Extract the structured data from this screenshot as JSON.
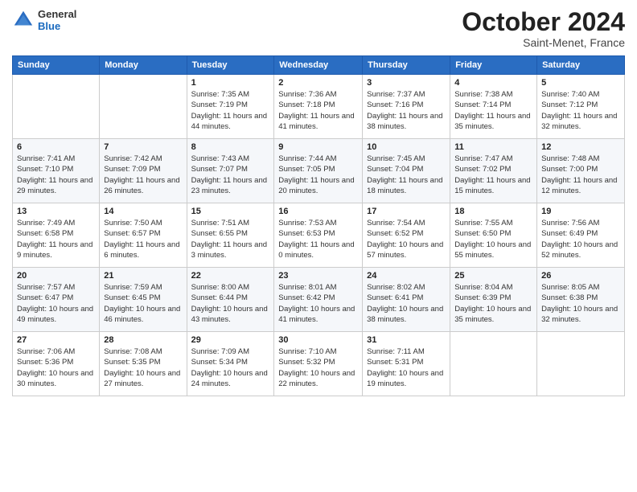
{
  "header": {
    "logo": {
      "general": "General",
      "blue": "Blue"
    },
    "title": "October 2024",
    "location": "Saint-Menet, France"
  },
  "days_of_week": [
    "Sunday",
    "Monday",
    "Tuesday",
    "Wednesday",
    "Thursday",
    "Friday",
    "Saturday"
  ],
  "weeks": [
    [
      {
        "day": "",
        "info": ""
      },
      {
        "day": "",
        "info": ""
      },
      {
        "day": "1",
        "sunrise": "Sunrise: 7:35 AM",
        "sunset": "Sunset: 7:19 PM",
        "daylight": "Daylight: 11 hours and 44 minutes."
      },
      {
        "day": "2",
        "sunrise": "Sunrise: 7:36 AM",
        "sunset": "Sunset: 7:18 PM",
        "daylight": "Daylight: 11 hours and 41 minutes."
      },
      {
        "day": "3",
        "sunrise": "Sunrise: 7:37 AM",
        "sunset": "Sunset: 7:16 PM",
        "daylight": "Daylight: 11 hours and 38 minutes."
      },
      {
        "day": "4",
        "sunrise": "Sunrise: 7:38 AM",
        "sunset": "Sunset: 7:14 PM",
        "daylight": "Daylight: 11 hours and 35 minutes."
      },
      {
        "day": "5",
        "sunrise": "Sunrise: 7:40 AM",
        "sunset": "Sunset: 7:12 PM",
        "daylight": "Daylight: 11 hours and 32 minutes."
      }
    ],
    [
      {
        "day": "6",
        "sunrise": "Sunrise: 7:41 AM",
        "sunset": "Sunset: 7:10 PM",
        "daylight": "Daylight: 11 hours and 29 minutes."
      },
      {
        "day": "7",
        "sunrise": "Sunrise: 7:42 AM",
        "sunset": "Sunset: 7:09 PM",
        "daylight": "Daylight: 11 hours and 26 minutes."
      },
      {
        "day": "8",
        "sunrise": "Sunrise: 7:43 AM",
        "sunset": "Sunset: 7:07 PM",
        "daylight": "Daylight: 11 hours and 23 minutes."
      },
      {
        "day": "9",
        "sunrise": "Sunrise: 7:44 AM",
        "sunset": "Sunset: 7:05 PM",
        "daylight": "Daylight: 11 hours and 20 minutes."
      },
      {
        "day": "10",
        "sunrise": "Sunrise: 7:45 AM",
        "sunset": "Sunset: 7:04 PM",
        "daylight": "Daylight: 11 hours and 18 minutes."
      },
      {
        "day": "11",
        "sunrise": "Sunrise: 7:47 AM",
        "sunset": "Sunset: 7:02 PM",
        "daylight": "Daylight: 11 hours and 15 minutes."
      },
      {
        "day": "12",
        "sunrise": "Sunrise: 7:48 AM",
        "sunset": "Sunset: 7:00 PM",
        "daylight": "Daylight: 11 hours and 12 minutes."
      }
    ],
    [
      {
        "day": "13",
        "sunrise": "Sunrise: 7:49 AM",
        "sunset": "Sunset: 6:58 PM",
        "daylight": "Daylight: 11 hours and 9 minutes."
      },
      {
        "day": "14",
        "sunrise": "Sunrise: 7:50 AM",
        "sunset": "Sunset: 6:57 PM",
        "daylight": "Daylight: 11 hours and 6 minutes."
      },
      {
        "day": "15",
        "sunrise": "Sunrise: 7:51 AM",
        "sunset": "Sunset: 6:55 PM",
        "daylight": "Daylight: 11 hours and 3 minutes."
      },
      {
        "day": "16",
        "sunrise": "Sunrise: 7:53 AM",
        "sunset": "Sunset: 6:53 PM",
        "daylight": "Daylight: 11 hours and 0 minutes."
      },
      {
        "day": "17",
        "sunrise": "Sunrise: 7:54 AM",
        "sunset": "Sunset: 6:52 PM",
        "daylight": "Daylight: 10 hours and 57 minutes."
      },
      {
        "day": "18",
        "sunrise": "Sunrise: 7:55 AM",
        "sunset": "Sunset: 6:50 PM",
        "daylight": "Daylight: 10 hours and 55 minutes."
      },
      {
        "day": "19",
        "sunrise": "Sunrise: 7:56 AM",
        "sunset": "Sunset: 6:49 PM",
        "daylight": "Daylight: 10 hours and 52 minutes."
      }
    ],
    [
      {
        "day": "20",
        "sunrise": "Sunrise: 7:57 AM",
        "sunset": "Sunset: 6:47 PM",
        "daylight": "Daylight: 10 hours and 49 minutes."
      },
      {
        "day": "21",
        "sunrise": "Sunrise: 7:59 AM",
        "sunset": "Sunset: 6:45 PM",
        "daylight": "Daylight: 10 hours and 46 minutes."
      },
      {
        "day": "22",
        "sunrise": "Sunrise: 8:00 AM",
        "sunset": "Sunset: 6:44 PM",
        "daylight": "Daylight: 10 hours and 43 minutes."
      },
      {
        "day": "23",
        "sunrise": "Sunrise: 8:01 AM",
        "sunset": "Sunset: 6:42 PM",
        "daylight": "Daylight: 10 hours and 41 minutes."
      },
      {
        "day": "24",
        "sunrise": "Sunrise: 8:02 AM",
        "sunset": "Sunset: 6:41 PM",
        "daylight": "Daylight: 10 hours and 38 minutes."
      },
      {
        "day": "25",
        "sunrise": "Sunrise: 8:04 AM",
        "sunset": "Sunset: 6:39 PM",
        "daylight": "Daylight: 10 hours and 35 minutes."
      },
      {
        "day": "26",
        "sunrise": "Sunrise: 8:05 AM",
        "sunset": "Sunset: 6:38 PM",
        "daylight": "Daylight: 10 hours and 32 minutes."
      }
    ],
    [
      {
        "day": "27",
        "sunrise": "Sunrise: 7:06 AM",
        "sunset": "Sunset: 5:36 PM",
        "daylight": "Daylight: 10 hours and 30 minutes."
      },
      {
        "day": "28",
        "sunrise": "Sunrise: 7:08 AM",
        "sunset": "Sunset: 5:35 PM",
        "daylight": "Daylight: 10 hours and 27 minutes."
      },
      {
        "day": "29",
        "sunrise": "Sunrise: 7:09 AM",
        "sunset": "Sunset: 5:34 PM",
        "daylight": "Daylight: 10 hours and 24 minutes."
      },
      {
        "day": "30",
        "sunrise": "Sunrise: 7:10 AM",
        "sunset": "Sunset: 5:32 PM",
        "daylight": "Daylight: 10 hours and 22 minutes."
      },
      {
        "day": "31",
        "sunrise": "Sunrise: 7:11 AM",
        "sunset": "Sunset: 5:31 PM",
        "daylight": "Daylight: 10 hours and 19 minutes."
      },
      {
        "day": "",
        "info": ""
      },
      {
        "day": "",
        "info": ""
      }
    ]
  ]
}
